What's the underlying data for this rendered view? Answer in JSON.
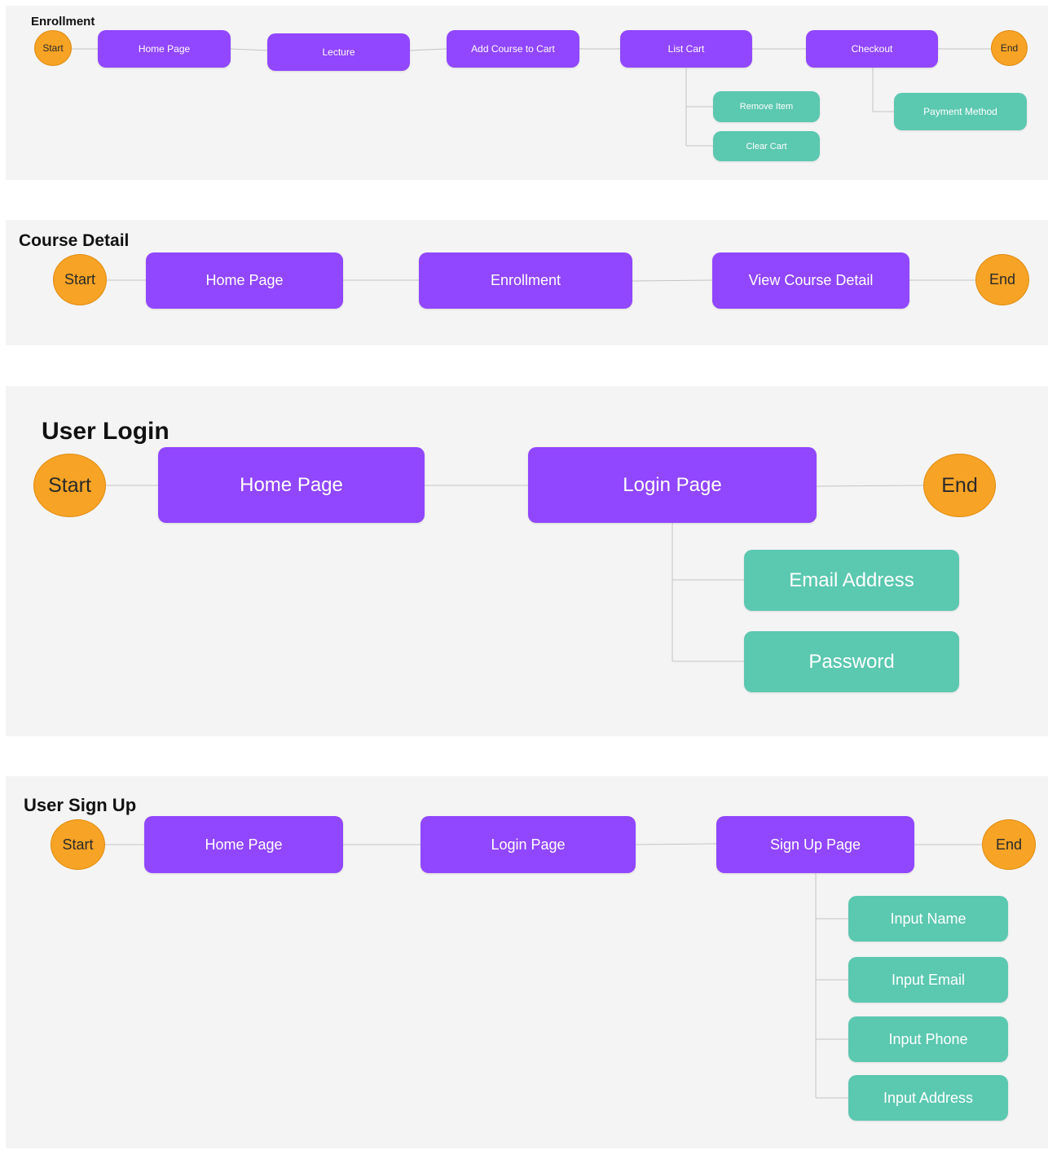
{
  "colors": {
    "page_node": "#9146ff",
    "sub_node": "#5bc8b0",
    "terminal": "#f7a325",
    "panel": "#f4f4f4",
    "connector": "#c4c4c4"
  },
  "enrollment": {
    "title": "Enrollment",
    "start": "Start",
    "home_page": "Home Page",
    "lecture": "Lecture",
    "add_course": "Add Course to Cart",
    "list_cart": "List Cart",
    "checkout": "Checkout",
    "end": "End",
    "remove_item": "Remove Item",
    "clear_cart": "Clear Cart",
    "payment_method": "Payment Method"
  },
  "course_detail": {
    "title": "Course Detail",
    "start": "Start",
    "home_page": "Home Page",
    "enrollment": "Enrollment",
    "view_course_detail": "View Course Detail",
    "end": "End"
  },
  "user_login": {
    "title": "User Login",
    "start": "Start",
    "home_page": "Home Page",
    "login_page": "Login Page",
    "end": "End",
    "email_address": "Email Address",
    "password": "Password"
  },
  "user_signup": {
    "title": "User Sign Up",
    "start": "Start",
    "home_page": "Home Page",
    "login_page": "Login Page",
    "signup_page": "Sign Up Page",
    "end": "End",
    "input_name": "Input Name",
    "input_email": "Input Email",
    "input_phone": "Input Phone",
    "input_address": "Input Address"
  }
}
